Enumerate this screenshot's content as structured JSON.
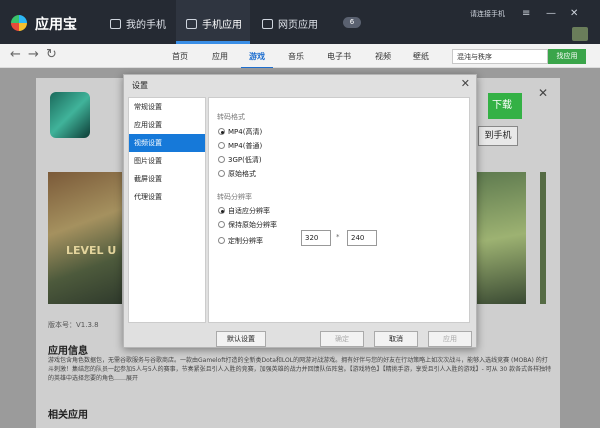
{
  "titlebar": {
    "app_name": "应用宝",
    "tabs": [
      {
        "label": "我的手机"
      },
      {
        "label": "手机应用"
      },
      {
        "label": "网页应用"
      }
    ],
    "badge_count": "6",
    "phone_connect": "请连接手机",
    "window_buttons": [
      "≡",
      "—",
      "✕"
    ]
  },
  "nav": {
    "categories": [
      "首页",
      "应用",
      "游戏",
      "音乐",
      "电子书",
      "视频",
      "壁纸"
    ],
    "search": {
      "value": "混沌与秩序",
      "button": "找应用"
    }
  },
  "detail": {
    "download_label": "下载",
    "to_phone_label": "到手机",
    "level_text": "LEVEL U",
    "version": "版本号：V1.3.8",
    "info_title": "应用信息",
    "info_text": "游戏包含角色数据包，无需谷歌服务与谷歌商店。一款由Gameloft打造的全新类Dota和LOL的网游对战游戏。拥有好伴与您的好友在行动策略上如次次战斗，能够入选线竞赛 (MOBA) 的打斗刺激！集结您的队员一起参加5人与5人的赛事，节奏紧张且引人入胜的竞赛，加强英雄的战力并回馈队伍阵营。【游戏特色】【精挑手游，享受且引人入胜的游戏】- 可从 30 款各式各样独特的英雄中选择您要的角色……展开",
    "related_title": "相关应用"
  },
  "dialog": {
    "title": "设置",
    "sidebar": [
      "常规设置",
      "应用设置",
      "视频设置",
      "图片设置",
      "截屏设置",
      "代理设置"
    ],
    "format_group": "转码格式",
    "formats": [
      "MP4(高清)",
      "MP4(普通)",
      "3GP(低清)",
      "原始格式"
    ],
    "res_group": "转码分辨率",
    "resolutions": [
      "自适应分辨率",
      "保持原始分辨率",
      "定制分辨率"
    ],
    "width": "320",
    "height": "240",
    "default_btn": "默认设置",
    "ok_btn": "确定",
    "cancel_btn": "取消",
    "apply_btn": "应用"
  }
}
